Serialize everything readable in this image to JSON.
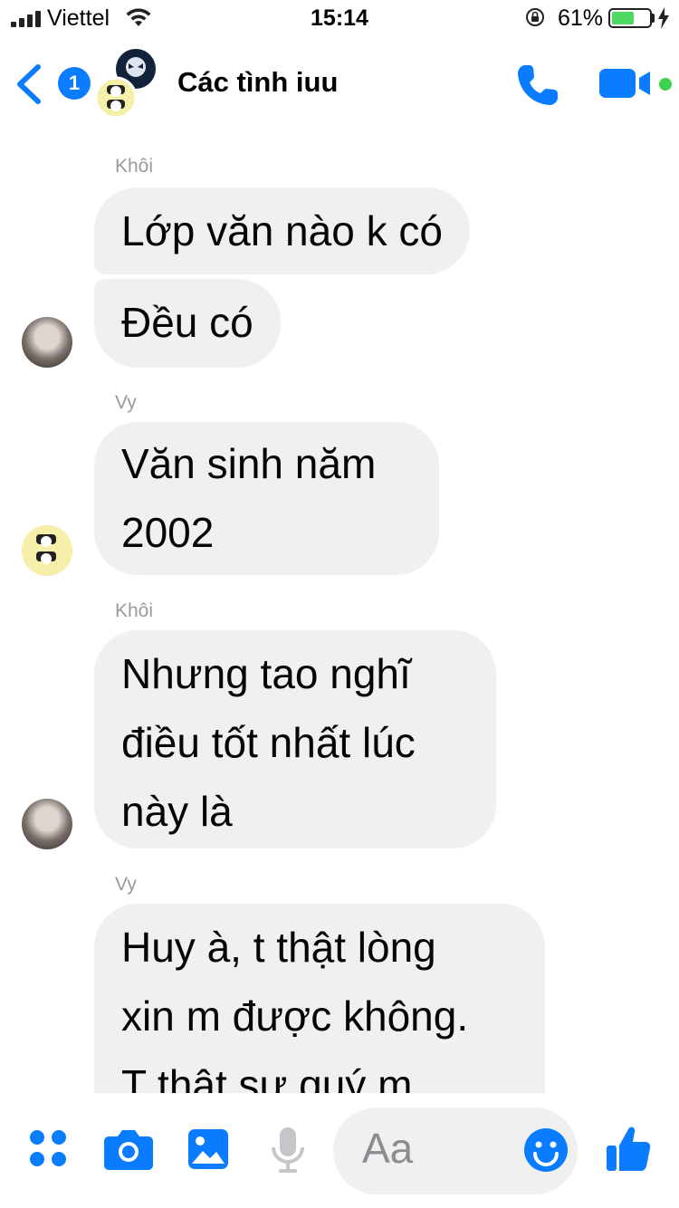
{
  "status_bar": {
    "carrier": "Viettel",
    "time": "15:14",
    "battery_percent": "61%",
    "battery_level": 0.61,
    "icons": [
      "signal-icon",
      "wifi-icon",
      "rotation-lock-icon",
      "battery-icon",
      "charging-bolt-icon"
    ]
  },
  "header": {
    "back_count": "1",
    "title": "Các tình iuu",
    "accent_color": "#0a7cff",
    "icons": [
      "back-chevron-icon",
      "phone-icon",
      "video-camera-icon"
    ]
  },
  "messages": [
    {
      "sender": "Khôi",
      "bubbles": [
        "Lớp văn nào k có",
        "Đều có"
      ]
    },
    {
      "sender": "Vy",
      "bubbles": [
        "Văn sinh năm\n2002"
      ]
    },
    {
      "sender": "Khôi",
      "bubbles": [
        "Nhưng tao nghĩ\nđiều tốt nhất lúc\nnày là"
      ]
    },
    {
      "sender": "Vy",
      "bubbles": [
        "Huy à, t thật lòng\nxin m được không.\nT thật sự quý m"
      ]
    }
  ],
  "composer": {
    "placeholder": "Aa",
    "icons": [
      "apps-grid-icon",
      "camera-icon",
      "photo-icon",
      "microphone-icon",
      "emoji-icon",
      "thumbs-up-icon"
    ]
  }
}
